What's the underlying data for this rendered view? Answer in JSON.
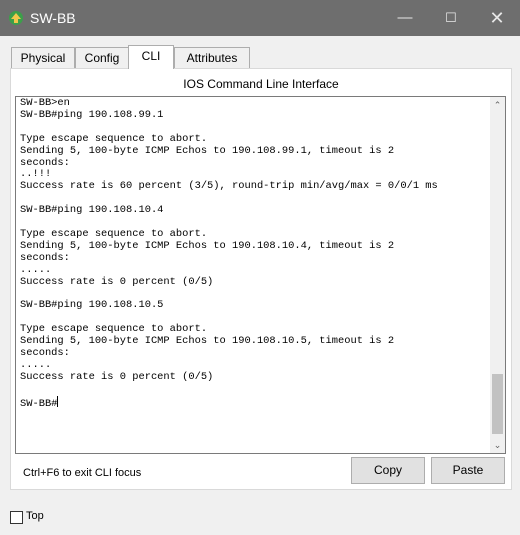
{
  "window": {
    "title": "SW-BB",
    "minimize_glyph": "—",
    "maximize_glyph": "☐",
    "close_glyph": "✕",
    "icon": "packet-tracer-device-icon"
  },
  "tabs": [
    {
      "label": "Physical",
      "active": false
    },
    {
      "label": "Config",
      "active": false
    },
    {
      "label": "CLI",
      "active": true
    },
    {
      "label": "Attributes",
      "active": false
    }
  ],
  "panel": {
    "title": "IOS Command Line Interface"
  },
  "console": {
    "lines": [
      "SW-BB>en",
      "SW-BB#ping 190.108.99.1",
      "",
      "Type escape sequence to abort.",
      "Sending 5, 100-byte ICMP Echos to 190.108.99.1, timeout is 2",
      "seconds:",
      "..!!!",
      "Success rate is 60 percent (3/5), round-trip min/avg/max = 0/0/1 ms",
      "",
      "SW-BB#ping 190.108.10.4",
      "",
      "Type escape sequence to abort.",
      "Sending 5, 100-byte ICMP Echos to 190.108.10.4, timeout is 2",
      "seconds:",
      ".....",
      "Success rate is 0 percent (0/5)",
      "",
      "SW-BB#ping 190.108.10.5",
      "",
      "Type escape sequence to abort.",
      "Sending 5, 100-byte ICMP Echos to 190.108.10.5, timeout is 2",
      "seconds:",
      ".....",
      "Success rate is 0 percent (0/5)",
      ""
    ],
    "prompt": "SW-BB#",
    "scroll_up_glyph": "⌃",
    "scroll_down_glyph": "⌄"
  },
  "footer": {
    "hint": "Ctrl+F6 to exit CLI focus",
    "copy_label": "Copy",
    "paste_label": "Paste"
  },
  "options": {
    "top_label": "Top",
    "top_checked": false
  }
}
